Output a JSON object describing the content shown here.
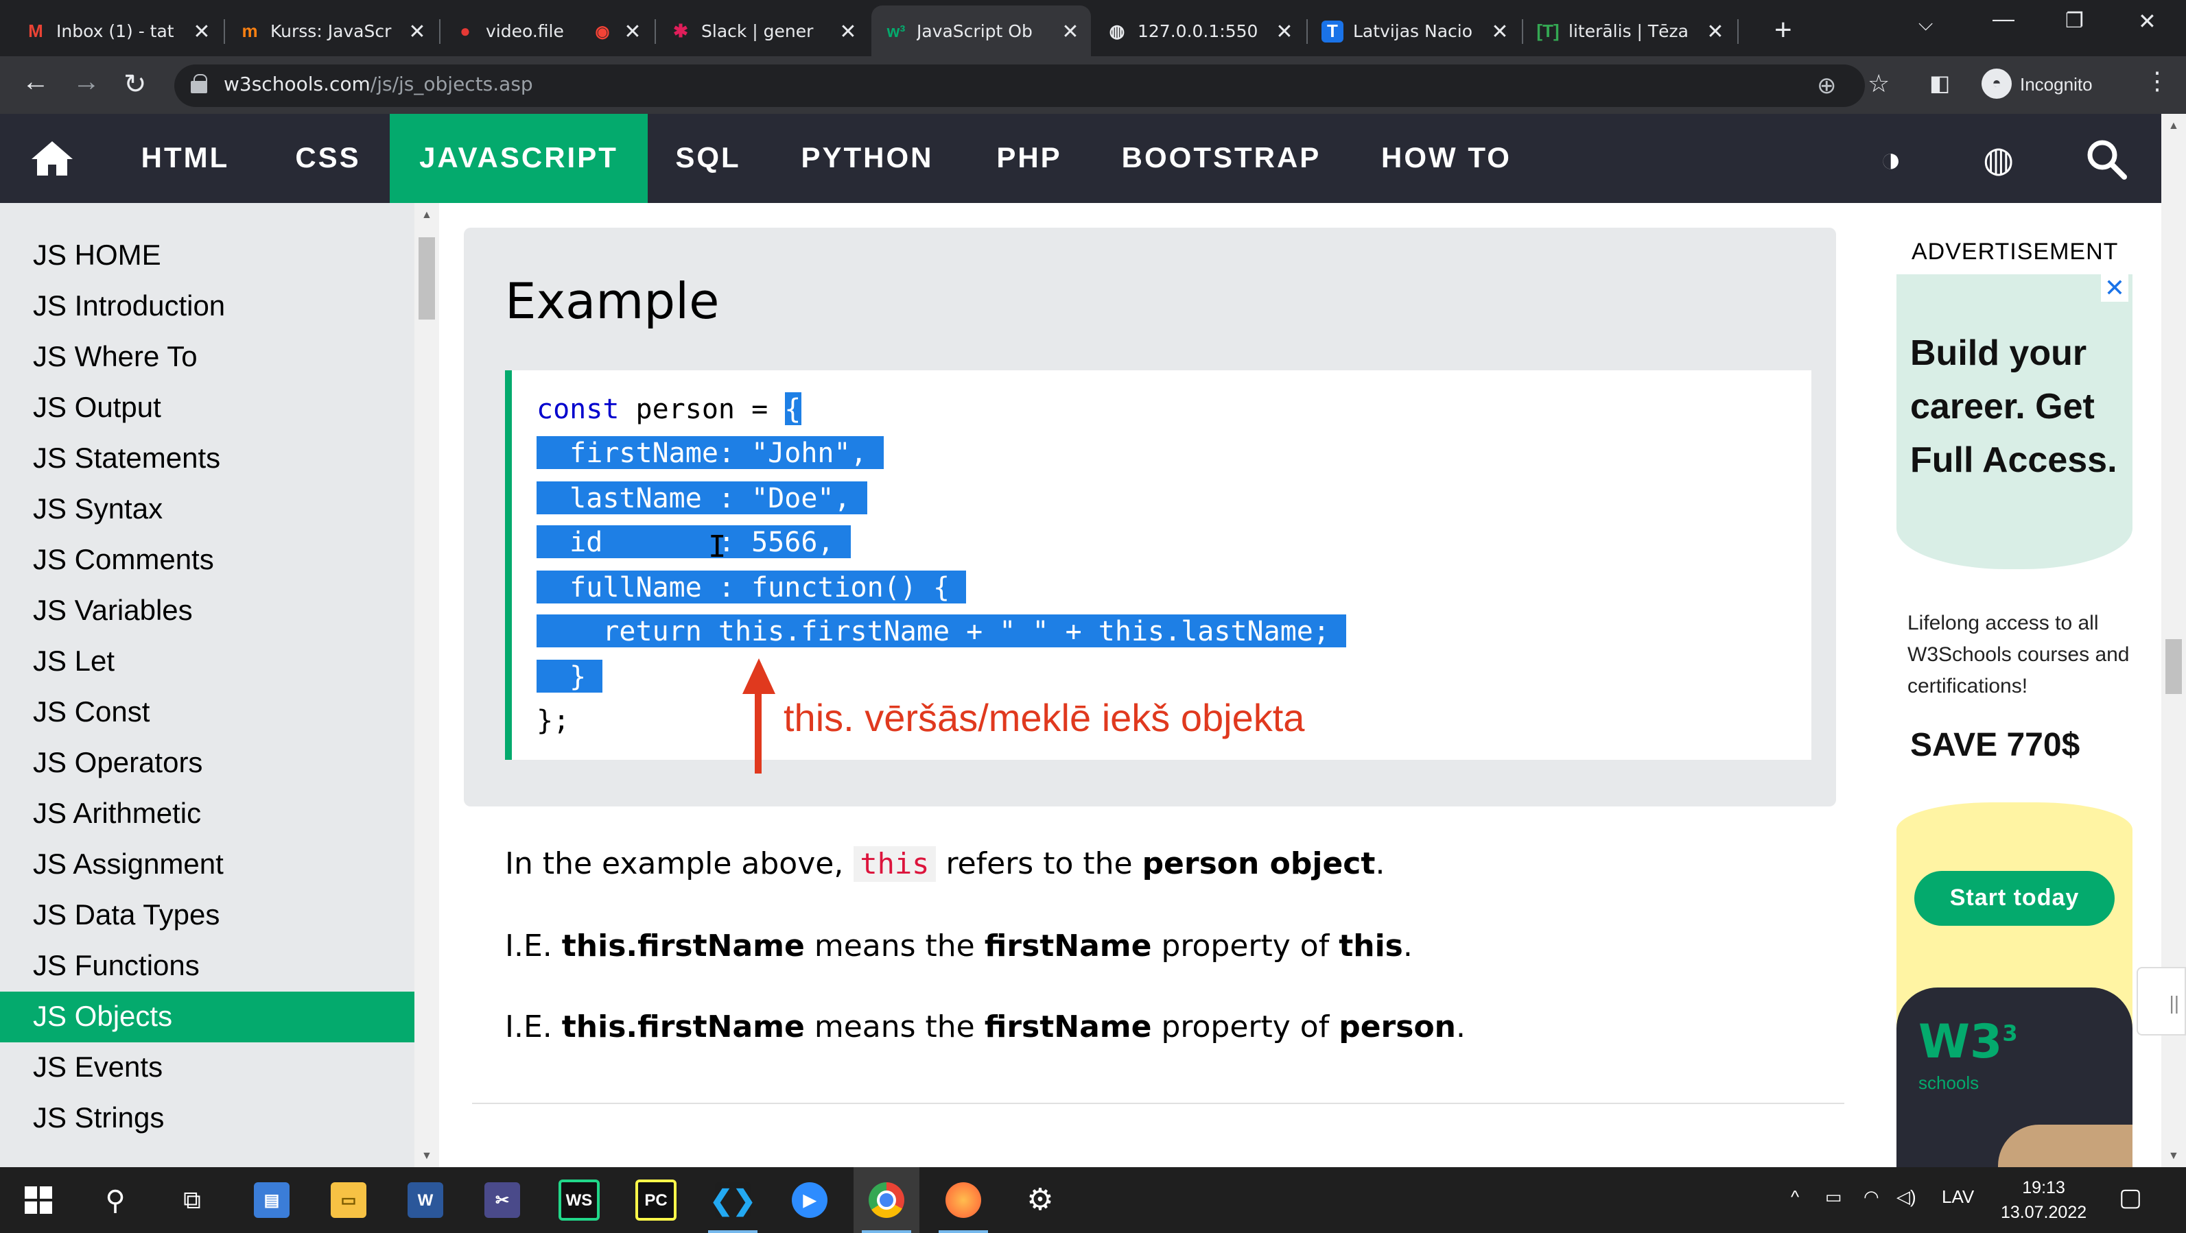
{
  "browser": {
    "tabs": [
      {
        "title": "Inbox (1) - tat",
        "icon": "gmail-icon"
      },
      {
        "title": "Kurss: JavaScr",
        "icon": "moodle-icon"
      },
      {
        "title": "video.file",
        "icon": "video-icon"
      },
      {
        "title": "Slack | gener",
        "icon": "slack-icon"
      },
      {
        "title": "JavaScript Ob",
        "icon": "w3schools-icon"
      },
      {
        "title": "127.0.0.1:550",
        "icon": "globe-icon"
      },
      {
        "title": "Latvijas Nacio",
        "icon": "tezaurs-icon"
      },
      {
        "title": "literālis | Tēza",
        "icon": "tezaurs-bracket-icon"
      }
    ],
    "active_tab": 4,
    "url_host": "w3schools.com",
    "url_path": "/js/js_objects.asp",
    "profile_label": "Incognito"
  },
  "topnav": {
    "items": [
      "HTML",
      "CSS",
      "JAVASCRIPT",
      "SQL",
      "PYTHON",
      "PHP",
      "BOOTSTRAP",
      "HOW TO"
    ],
    "active": "JAVASCRIPT"
  },
  "sidebar": {
    "items": [
      "JS HOME",
      "JS Introduction",
      "JS Where To",
      "JS Output",
      "JS Statements",
      "JS Syntax",
      "JS Comments",
      "JS Variables",
      "JS Let",
      "JS Const",
      "JS Operators",
      "JS Arithmetic",
      "JS Assignment",
      "JS Data Types",
      "JS Functions",
      "JS Objects",
      "JS Events",
      "JS Strings"
    ],
    "active": "JS Objects"
  },
  "example": {
    "title": "Example",
    "code_lines": [
      {
        "pre": "const",
        "rest": " person = ",
        "sel": "{"
      },
      {
        "sel": "  firstName: \"John\", "
      },
      {
        "sel": "  lastName : \"Doe\", "
      },
      {
        "sel": "  id       : 5566, "
      },
      {
        "sel": "  fullName : function() { "
      },
      {
        "sel": "    return this.firstName + \" \" + this.lastName; "
      },
      {
        "sel": "  } "
      },
      {
        "rest": "};"
      }
    ],
    "annotation": "this.  vēršās/meklē iekš objekta"
  },
  "text": {
    "p1": {
      "before": "In the example above, ",
      "code": "this",
      "middle": " refers to the ",
      "bold": "person object",
      "after": "."
    },
    "p2": {
      "prefix": "I.E. ",
      "b1": "this.firstName",
      "mid1": " means the ",
      "b2": "firstName",
      "mid2": " property of ",
      "b3": "this",
      "end": "."
    },
    "p3": {
      "prefix": "I.E. ",
      "b1": "this.firstName",
      "mid1": " means the ",
      "b2": "firstName",
      "mid2": " property of ",
      "b3": "person",
      "end": "."
    }
  },
  "ad": {
    "label": "ADVERTISEMENT",
    "headline": "Build your career. Get Full Access.",
    "subtext": "Lifelong access to all W3Schools courses and certifications!",
    "save": "SAVE 770$",
    "button": "Start today",
    "logo": "W3",
    "logo_sup": "3",
    "logo_sub": "schools"
  },
  "taskbar": {
    "language": "LAV",
    "time": "19:13",
    "date": "13.07.2022"
  },
  "colors": {
    "brand_green": "#04aa6d",
    "nav_dark": "#282a35",
    "selection_blue": "#1e7fe5",
    "annotation_red": "#e0391e"
  }
}
